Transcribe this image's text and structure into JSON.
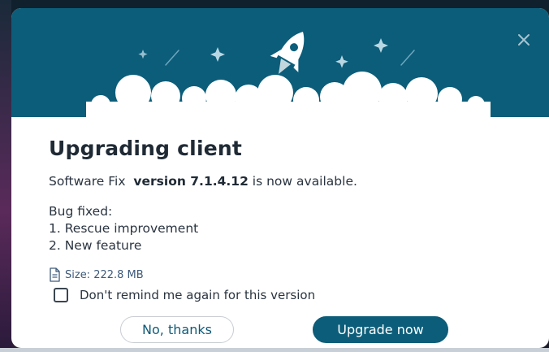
{
  "dialog": {
    "title": "Upgrading client",
    "availability": {
      "product": "Software Fix",
      "version_label": "version 7.1.4.12",
      "suffix": "is now available."
    },
    "notes": {
      "heading": "Bug fixed:",
      "items": [
        "1. Rescue improvement",
        "2. New feature"
      ]
    },
    "size_label": "Size: 222.8 MB",
    "remind_label": "Don't remind me again for this version",
    "remind_checked": false,
    "buttons": {
      "secondary_label": "No, thanks",
      "primary_label": "Upgrade now"
    }
  },
  "icons": {
    "close": "close-icon",
    "rocket": "rocket-icon",
    "file": "file-icon"
  },
  "colors": {
    "brand": "#0c5d79",
    "title_text": "#1f2a35",
    "body_text": "#2a3440",
    "size_text": "#3d5a7a"
  }
}
